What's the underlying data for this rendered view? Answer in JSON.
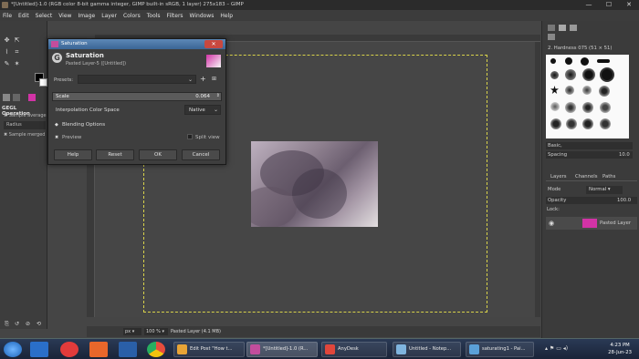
{
  "window": {
    "title": "*[Untitled]-1.0 (RGB color 8-bit gamma integer, GIMP built-in sRGB, 1 layer) 275x183 – GIMP",
    "minimize": "—",
    "maximize": "☐",
    "close": "✕"
  },
  "menubar": [
    "File",
    "Edit",
    "Select",
    "View",
    "Image",
    "Layer",
    "Colors",
    "Tools",
    "Filters",
    "Windows",
    "Help"
  ],
  "toolbox": {
    "gegl_title": "GEGL Operation",
    "sample_average": "Sample average",
    "radius_label": "Radius",
    "sample_merged": "Sample merged"
  },
  "dialog": {
    "window_title": "Saturation",
    "heading": "Saturation",
    "subheading": "Pasted Layer-5 ([Untitled])",
    "presets_label": "Presets:",
    "scale_label": "Scale",
    "scale_value": "0.064",
    "interp_label": "Interpolation Color Space",
    "interp_value": "Native",
    "blending_options": "Blending Options",
    "preview_label": "Preview",
    "split_view_label": "Split view",
    "buttons": {
      "help": "Help",
      "reset": "Reset",
      "ok": "OK",
      "cancel": "Cancel"
    }
  },
  "statusbar": {
    "unit": "px",
    "zoom": "100 %",
    "layer_info": "Pasted Layer (4.1 MB)"
  },
  "rightdock": {
    "brush_header": "2. Hardness 075 (51 × 51)",
    "brush_name": "Basic,",
    "spacing_label": "Spacing",
    "spacing_value": "10.0",
    "tabs": [
      "Layers",
      "Channels",
      "Paths"
    ],
    "mode_label": "Mode",
    "mode_value": "Normal",
    "opacity_label": "Opacity",
    "opacity_value": "100.0",
    "lock_label": "Lock:",
    "layer_name": "Pasted Layer"
  },
  "taskbar": {
    "items": [
      {
        "label": "Edit Post \"How t...",
        "color": "#e8a436"
      },
      {
        "label": "*[Untitled]-1.0 (R...",
        "color": "#c24d9c"
      },
      {
        "label": "AnyDesk",
        "color": "#e0463b"
      },
      {
        "label": "Untitled - Notep...",
        "color": "#7fb4de"
      },
      {
        "label": "saturating1 - Pai...",
        "color": "#5aa0d8"
      }
    ],
    "time": "4:23 PM",
    "date": "28-Jun-23"
  }
}
